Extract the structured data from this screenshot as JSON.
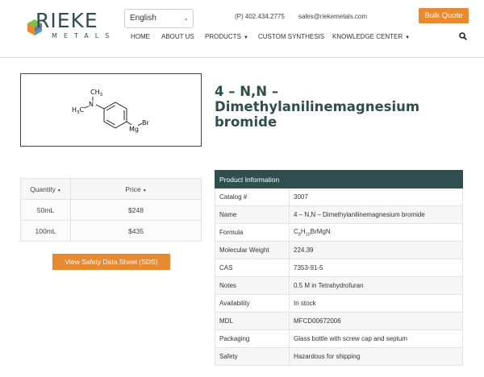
{
  "brand": {
    "name": "RIEKE",
    "sub": "METALS"
  },
  "header": {
    "language": "English",
    "phone": "(P) 402.434.2775",
    "email": "sales@riekemetals.com",
    "bulk_quote": "Bulk Quote"
  },
  "nav": {
    "items": [
      {
        "label": "HOME"
      },
      {
        "label": "ABOUT US"
      },
      {
        "label": "PRODUCTS"
      },
      {
        "label": "CUSTOM SYNTHESIS"
      },
      {
        "label": "KNOWLEDGE CENTER"
      }
    ],
    "search_icon": "search-icon"
  },
  "product": {
    "title_line1": "4 – N,N –",
    "title_line2": "Dimethylanilinemagnesium",
    "title_line3": "bromide",
    "structure_labels": {
      "me1": "CH",
      "me1_sub": "3",
      "n": "N",
      "me2": "H",
      "me2_sub": "3",
      "me2_c": "C",
      "mg": "Mg",
      "br": "Br"
    }
  },
  "pricing": {
    "headers": {
      "quantity": "Quantity",
      "price": "Price"
    },
    "rows": [
      {
        "quantity": "50mL",
        "price": "$248"
      },
      {
        "quantity": "100mL",
        "price": "$435"
      }
    ]
  },
  "sds_button": "View Safety Data Sheet (SDS)",
  "info": {
    "heading": "Product Information",
    "rows": [
      {
        "label": "Catalog #",
        "value": "3007"
      },
      {
        "label": "Name",
        "value": "4 – N,N – Dimethylanilinemagnesium bromide"
      },
      {
        "label": "Formula",
        "value": "C8H10BrMgN"
      },
      {
        "label": "Molecular Weight",
        "value": "224.39"
      },
      {
        "label": "CAS",
        "value": "7353-91-5"
      },
      {
        "label": "Notes",
        "value": "0.5 M in Tetrahydrofuran"
      },
      {
        "label": "Availability",
        "value": "In stock"
      },
      {
        "label": "MDL",
        "value": "MFCD00672006"
      },
      {
        "label": "Packaging",
        "value": "Glass bottle with screw cap and septum"
      },
      {
        "label": "Safety",
        "value": "Hazardous for shipping"
      }
    ],
    "formula_parts": {
      "c": "C",
      "c_n": "8",
      "h": "H",
      "h_n": "10",
      "rest": "BrMgN"
    }
  },
  "colors": {
    "accent": "#e78a31",
    "brand_dark": "#2f4f4f"
  }
}
